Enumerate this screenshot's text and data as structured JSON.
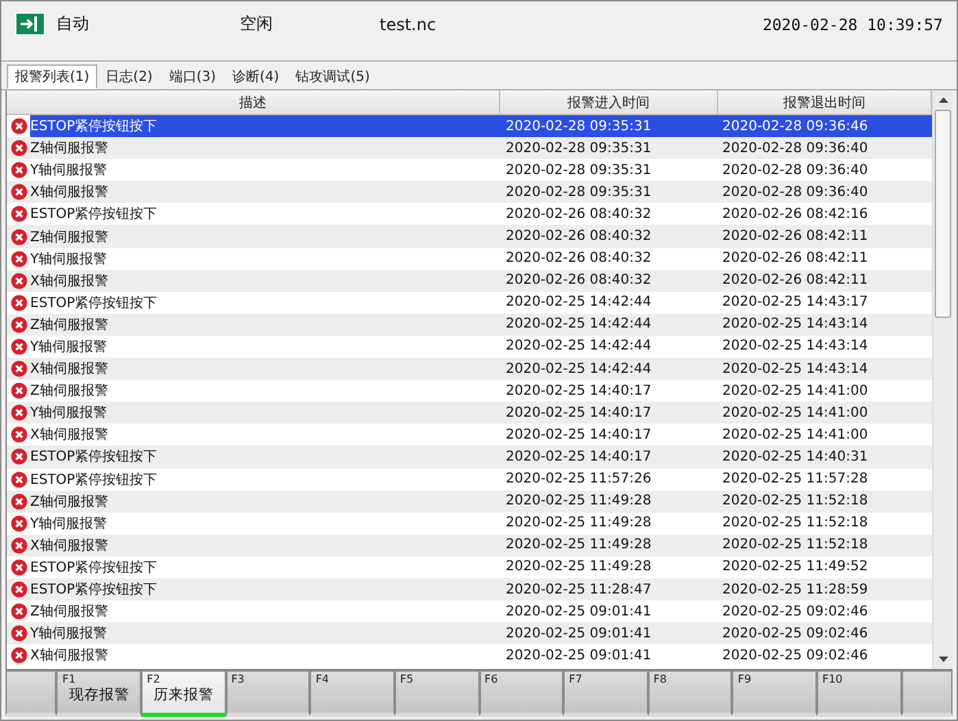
{
  "header": {
    "mode": "自动",
    "state": "空闲",
    "file": "test.nc",
    "datetime": "2020-02-28 10:39:57"
  },
  "tabs": [
    {
      "label": "报警列表(1)",
      "selected": true
    },
    {
      "label": "日志(2)",
      "selected": false
    },
    {
      "label": "端口(3)",
      "selected": false
    },
    {
      "label": "诊断(4)",
      "selected": false
    },
    {
      "label": "钻攻调试(5)",
      "selected": false
    }
  ],
  "table": {
    "columns": [
      "描述",
      "报警进入时间",
      "报警退出时间"
    ],
    "rows": [
      {
        "description": "ESTOP紧停按钮按下",
        "enter": "2020-02-28 09:35:31",
        "exit": "2020-02-28 09:36:46",
        "selected": true
      },
      {
        "description": "Z轴伺服报警",
        "enter": "2020-02-28 09:35:31",
        "exit": "2020-02-28 09:36:40",
        "selected": false
      },
      {
        "description": "Y轴伺服报警",
        "enter": "2020-02-28 09:35:31",
        "exit": "2020-02-28 09:36:40",
        "selected": false
      },
      {
        "description": "X轴伺服报警",
        "enter": "2020-02-28 09:35:31",
        "exit": "2020-02-28 09:36:40",
        "selected": false
      },
      {
        "description": "ESTOP紧停按钮按下",
        "enter": "2020-02-26 08:40:32",
        "exit": "2020-02-26 08:42:16",
        "selected": false
      },
      {
        "description": "Z轴伺服报警",
        "enter": "2020-02-26 08:40:32",
        "exit": "2020-02-26 08:42:11",
        "selected": false
      },
      {
        "description": "Y轴伺服报警",
        "enter": "2020-02-26 08:40:32",
        "exit": "2020-02-26 08:42:11",
        "selected": false
      },
      {
        "description": "X轴伺服报警",
        "enter": "2020-02-26 08:40:32",
        "exit": "2020-02-26 08:42:11",
        "selected": false
      },
      {
        "description": "ESTOP紧停按钮按下",
        "enter": "2020-02-25 14:42:44",
        "exit": "2020-02-25 14:43:17",
        "selected": false
      },
      {
        "description": "Z轴伺服报警",
        "enter": "2020-02-25 14:42:44",
        "exit": "2020-02-25 14:43:14",
        "selected": false
      },
      {
        "description": "Y轴伺服报警",
        "enter": "2020-02-25 14:42:44",
        "exit": "2020-02-25 14:43:14",
        "selected": false
      },
      {
        "description": "X轴伺服报警",
        "enter": "2020-02-25 14:42:44",
        "exit": "2020-02-25 14:43:14",
        "selected": false
      },
      {
        "description": "Z轴伺服报警",
        "enter": "2020-02-25 14:40:17",
        "exit": "2020-02-25 14:41:00",
        "selected": false
      },
      {
        "description": "Y轴伺服报警",
        "enter": "2020-02-25 14:40:17",
        "exit": "2020-02-25 14:41:00",
        "selected": false
      },
      {
        "description": "X轴伺服报警",
        "enter": "2020-02-25 14:40:17",
        "exit": "2020-02-25 14:41:00",
        "selected": false
      },
      {
        "description": "ESTOP紧停按钮按下",
        "enter": "2020-02-25 14:40:17",
        "exit": "2020-02-25 14:40:31",
        "selected": false
      },
      {
        "description": "ESTOP紧停按钮按下",
        "enter": "2020-02-25 11:57:26",
        "exit": "2020-02-25 11:57:28",
        "selected": false
      },
      {
        "description": "Z轴伺服报警",
        "enter": "2020-02-25 11:49:28",
        "exit": "2020-02-25 11:52:18",
        "selected": false
      },
      {
        "description": "Y轴伺服报警",
        "enter": "2020-02-25 11:49:28",
        "exit": "2020-02-25 11:52:18",
        "selected": false
      },
      {
        "description": "X轴伺服报警",
        "enter": "2020-02-25 11:49:28",
        "exit": "2020-02-25 11:52:18",
        "selected": false
      },
      {
        "description": "ESTOP紧停按钮按下",
        "enter": "2020-02-25 11:49:28",
        "exit": "2020-02-25 11:49:52",
        "selected": false
      },
      {
        "description": "ESTOP紧停按钮按下",
        "enter": "2020-02-25 11:28:47",
        "exit": "2020-02-25 11:28:59",
        "selected": false
      },
      {
        "description": "Z轴伺服报警",
        "enter": "2020-02-25 09:01:41",
        "exit": "2020-02-25 09:02:46",
        "selected": false
      },
      {
        "description": "Y轴伺服报警",
        "enter": "2020-02-25 09:01:41",
        "exit": "2020-02-25 09:02:46",
        "selected": false
      },
      {
        "description": "X轴伺服报警",
        "enter": "2020-02-25 09:01:41",
        "exit": "2020-02-25 09:02:46",
        "selected": false
      }
    ]
  },
  "function_keys": [
    {
      "key": "F1",
      "label": "现存报警",
      "selected": false
    },
    {
      "key": "F2",
      "label": "历来报警",
      "selected": true
    },
    {
      "key": "F3",
      "selected": false
    },
    {
      "key": "F4",
      "selected": false
    },
    {
      "key": "F5",
      "selected": false
    },
    {
      "key": "F6",
      "selected": false
    },
    {
      "key": "F7",
      "selected": false
    },
    {
      "key": "F8",
      "selected": false
    },
    {
      "key": "F9",
      "selected": false
    },
    {
      "key": "F10",
      "selected": false
    }
  ]
}
